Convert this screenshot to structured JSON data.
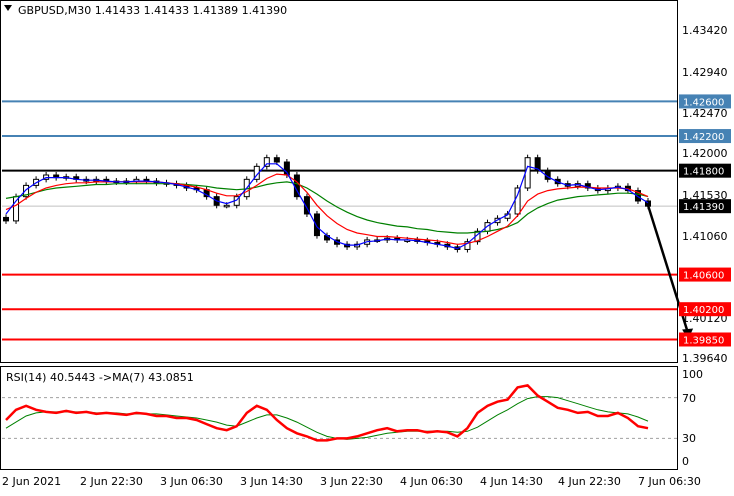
{
  "header": {
    "symbol_text": "GBPUSD,M30  1.41433 1.41433 1.41389 1.41390",
    "collapse_icon": "triangle-down-icon"
  },
  "colors": {
    "blue_level": "#4682b4",
    "red_level": "#ff0000",
    "black_level": "#000000",
    "candle_body": "#000000",
    "ma_fast": "#0000ff",
    "ma_mid": "#ff0000",
    "ma_slow": "#008000",
    "rsi": "#ff0000",
    "rsi_ma": "#008000",
    "grid": "#c0c0c0"
  },
  "chart_data": [
    {
      "type": "candlestick",
      "title": "GBPUSD,M30",
      "ohlc_last": {
        "open": 1.41433,
        "high": 1.41433,
        "low": 1.41389,
        "close": 1.4139
      },
      "ylim": [
        1.3959,
        1.4376
      ],
      "y_ticks": [
        "1.43420",
        "1.42940",
        "1.42470",
        "1.42000",
        "1.41530",
        "1.41060",
        "1.40590",
        "1.40120",
        "1.39640"
      ],
      "x_ticks": [
        "2 Jun 2021",
        "2 Jun 22:30",
        "3 Jun 06:30",
        "3 Jun 14:30",
        "3 Jun 22:30",
        "4 Jun 06:30",
        "4 Jun 14:30",
        "4 Jun 22:30",
        "7 Jun 06:30"
      ],
      "current_price_label": "1.41390",
      "levels": [
        {
          "value": 1.426,
          "label": "1.42600",
          "color": "#4682b4"
        },
        {
          "value": 1.422,
          "label": "1.42200",
          "color": "#4682b4"
        },
        {
          "value": 1.418,
          "label": "1.41800",
          "color": "#000000"
        },
        {
          "value": 1.406,
          "label": "1.40600",
          "color": "#ff0000"
        },
        {
          "value": 1.402,
          "label": "1.40200",
          "color": "#ff0000"
        },
        {
          "value": 1.3985,
          "label": "1.39850",
          "color": "#ff0000"
        }
      ],
      "close_series": [
        1.4122,
        1.415,
        1.4163,
        1.417,
        1.4175,
        1.4172,
        1.4173,
        1.417,
        1.4168,
        1.417,
        1.4168,
        1.4167,
        1.4168,
        1.417,
        1.4168,
        1.4166,
        1.4165,
        1.4163,
        1.416,
        1.4158,
        1.415,
        1.414,
        1.414,
        1.415,
        1.417,
        1.4185,
        1.4195,
        1.419,
        1.4175,
        1.415,
        1.413,
        1.4105,
        1.41,
        1.4095,
        1.4092,
        1.4095,
        1.41,
        1.41,
        1.4102,
        1.41,
        1.41,
        1.4099,
        1.4097,
        1.4095,
        1.4092,
        1.4089,
        1.4098,
        1.411,
        1.412,
        1.4125,
        1.413,
        1.416,
        1.4195,
        1.418,
        1.417,
        1.4165,
        1.4162,
        1.4165,
        1.416,
        1.4157,
        1.416,
        1.4162,
        1.4157,
        1.4145,
        1.4139
      ],
      "ma_fast_series": [
        1.413,
        1.4145,
        1.4158,
        1.4166,
        1.4172,
        1.4172,
        1.4172,
        1.417,
        1.4169,
        1.4169,
        1.4168,
        1.4167,
        1.4167,
        1.4168,
        1.4168,
        1.4167,
        1.4166,
        1.4164,
        1.4161,
        1.4158,
        1.4152,
        1.4145,
        1.4142,
        1.4146,
        1.416,
        1.4175,
        1.4188,
        1.4188,
        1.4178,
        1.4157,
        1.4137,
        1.4115,
        1.4105,
        1.4098,
        1.4094,
        1.4094,
        1.4098,
        1.4099,
        1.4101,
        1.41,
        1.41,
        1.4099,
        1.4097,
        1.4095,
        1.4093,
        1.409,
        1.4096,
        1.4106,
        1.4116,
        1.4123,
        1.4129,
        1.4152,
        1.4185,
        1.4182,
        1.4173,
        1.4167,
        1.4163,
        1.4164,
        1.4161,
        1.4158,
        1.4159,
        1.4161,
        1.4158,
        1.415,
        1.4143
      ],
      "ma_mid_series": [
        1.4135,
        1.414,
        1.4148,
        1.4155,
        1.416,
        1.4163,
        1.4165,
        1.4166,
        1.4166,
        1.4167,
        1.4167,
        1.4167,
        1.4167,
        1.4167,
        1.4167,
        1.4167,
        1.4166,
        1.4165,
        1.4163,
        1.4161,
        1.4158,
        1.4154,
        1.4151,
        1.4151,
        1.4156,
        1.4163,
        1.4171,
        1.4176,
        1.4175,
        1.4167,
        1.4155,
        1.414,
        1.4128,
        1.4119,
        1.4112,
        1.4108,
        1.4106,
        1.4104,
        1.4104,
        1.4103,
        1.4102,
        1.4101,
        1.41,
        1.4099,
        1.4097,
        1.4095,
        1.4096,
        1.4099,
        1.4104,
        1.411,
        1.4116,
        1.4128,
        1.4145,
        1.4153,
        1.4157,
        1.4159,
        1.416,
        1.4161,
        1.4161,
        1.416,
        1.416,
        1.416,
        1.4159,
        1.4155,
        1.415
      ],
      "ma_slow_series": [
        1.4148,
        1.415,
        1.4152,
        1.4155,
        1.4158,
        1.416,
        1.4161,
        1.4162,
        1.4163,
        1.4164,
        1.4164,
        1.4165,
        1.4165,
        1.4165,
        1.4165,
        1.4165,
        1.4165,
        1.4165,
        1.4164,
        1.4163,
        1.4162,
        1.416,
        1.4159,
        1.4158,
        1.4159,
        1.4161,
        1.4164,
        1.4166,
        1.4167,
        1.4165,
        1.416,
        1.4153,
        1.4145,
        1.4138,
        1.4132,
        1.4127,
        1.4123,
        1.412,
        1.4118,
        1.4116,
        1.4115,
        1.4113,
        1.4112,
        1.411,
        1.4109,
        1.4108,
        1.4108,
        1.4109,
        1.411,
        1.4112,
        1.4115,
        1.412,
        1.413,
        1.4137,
        1.4142,
        1.4146,
        1.4148,
        1.415,
        1.4151,
        1.4152,
        1.4153,
        1.4154,
        1.4154,
        1.4153,
        1.415
      ],
      "annotation_arrow": {
        "from": [
          64,
          1.414
        ],
        "to": [
          68,
          1.3985
        ]
      }
    },
    {
      "type": "line",
      "title": "RSI(14) 40.5443  ->MA(7) 43.0851",
      "ylim": [
        0,
        100
      ],
      "y_ticks": [
        "100",
        "70",
        "30",
        "0"
      ],
      "levels": [
        70,
        30
      ],
      "rsi_series": [
        48,
        58,
        62,
        58,
        56,
        55,
        57,
        55,
        56,
        54,
        55,
        54,
        53,
        55,
        54,
        52,
        52,
        50,
        50,
        48,
        44,
        40,
        38,
        42,
        55,
        62,
        58,
        48,
        40,
        35,
        32,
        28,
        28,
        30,
        30,
        32,
        35,
        38,
        40,
        37,
        38,
        38,
        36,
        37,
        36,
        32,
        40,
        55,
        62,
        66,
        68,
        80,
        82,
        72,
        66,
        60,
        58,
        55,
        56,
        52,
        52,
        55,
        50,
        42,
        40
      ],
      "rsi_ma_series": [
        40,
        46,
        52,
        55,
        56,
        56,
        56,
        56,
        56,
        55,
        55,
        55,
        54,
        54,
        54,
        54,
        53,
        52,
        51,
        50,
        48,
        46,
        43,
        42,
        46,
        50,
        53,
        53,
        50,
        46,
        41,
        36,
        32,
        30,
        29,
        30,
        31,
        33,
        35,
        36,
        37,
        37,
        37,
        37,
        37,
        36,
        37,
        41,
        47,
        53,
        58,
        64,
        69,
        71,
        71,
        70,
        67,
        64,
        61,
        58,
        56,
        55,
        54,
        51,
        47
      ]
    }
  ]
}
